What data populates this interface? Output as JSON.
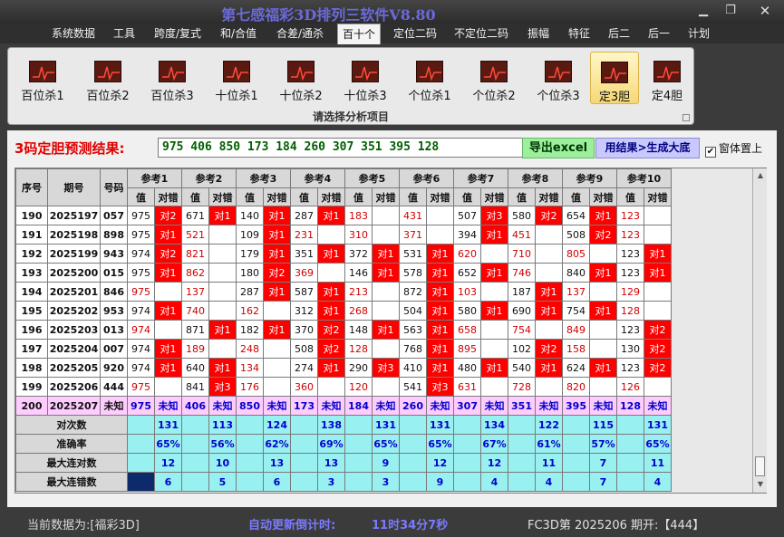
{
  "window": {
    "title": "第七感福彩3D排列三软件V8.80"
  },
  "menu": [
    "系统数据",
    "工具",
    "跨度/复式",
    "和/合值",
    "合差/通杀",
    "百十个",
    "定位二码",
    "不定位二码",
    "振幅",
    "特征",
    "后二",
    "后一",
    "计划"
  ],
  "active_menu": "百十个",
  "ribbon": {
    "buttons": [
      "百位杀1",
      "百位杀2",
      "百位杀3",
      "十位杀1",
      "十位杀2",
      "十位杀3",
      "个位杀1",
      "个位杀2",
      "个位杀3",
      "定3胆",
      "定4胆"
    ],
    "active": "定3胆",
    "caption": "请选择分析项目"
  },
  "prediction": {
    "label": "3码定胆预测结果:",
    "value": "975 406 850 173 184 260 307 351 395 128",
    "export_button": "导出excel",
    "bigbase_button": "用结果>生成大底",
    "pin_label": "窗体置上",
    "pin_checked": "✔"
  },
  "table": {
    "headers": {
      "seq": "序号",
      "period": "期号",
      "number": "号码",
      "val": "值",
      "hit": "对错"
    },
    "refs": [
      "参考1",
      "参考2",
      "参考3",
      "参考4",
      "参考5",
      "参考6",
      "参考7",
      "参考8",
      "参考9",
      "参考10"
    ],
    "rows": [
      {
        "seq": "190",
        "period": "2025197",
        "num": "057",
        "cells": [
          [
            "975",
            "对2"
          ],
          [
            "671",
            "对1"
          ],
          [
            "140",
            "对1"
          ],
          [
            "287",
            "对1"
          ],
          [
            "183",
            ""
          ],
          [
            "431",
            ""
          ],
          [
            "507",
            "对3"
          ],
          [
            "580",
            "对2"
          ],
          [
            "654",
            "对1"
          ],
          [
            "123",
            ""
          ]
        ]
      },
      {
        "seq": "191",
        "period": "2025198",
        "num": "898",
        "cells": [
          [
            "975",
            "对1"
          ],
          [
            "521",
            ""
          ],
          [
            "109",
            "对1"
          ],
          [
            "231",
            ""
          ],
          [
            "310",
            ""
          ],
          [
            "371",
            ""
          ],
          [
            "394",
            "对1"
          ],
          [
            "451",
            ""
          ],
          [
            "508",
            "对2"
          ],
          [
            "123",
            ""
          ]
        ]
      },
      {
        "seq": "192",
        "period": "2025199",
        "num": "943",
        "cells": [
          [
            "974",
            "对2"
          ],
          [
            "821",
            ""
          ],
          [
            "179",
            "对1"
          ],
          [
            "351",
            "对1"
          ],
          [
            "372",
            "对1"
          ],
          [
            "531",
            "对1"
          ],
          [
            "620",
            ""
          ],
          [
            "710",
            ""
          ],
          [
            "805",
            ""
          ],
          [
            "123",
            "对1"
          ]
        ]
      },
      {
        "seq": "193",
        "period": "2025200",
        "num": "015",
        "cells": [
          [
            "975",
            "对1"
          ],
          [
            "862",
            ""
          ],
          [
            "180",
            "对2"
          ],
          [
            "369",
            ""
          ],
          [
            "146",
            "对1"
          ],
          [
            "578",
            "对1"
          ],
          [
            "652",
            "对1"
          ],
          [
            "746",
            ""
          ],
          [
            "840",
            "对1"
          ],
          [
            "123",
            "对1"
          ]
        ]
      },
      {
        "seq": "194",
        "period": "2025201",
        "num": "846",
        "cells": [
          [
            "975",
            ""
          ],
          [
            "137",
            ""
          ],
          [
            "287",
            "对1"
          ],
          [
            "587",
            "对1"
          ],
          [
            "213",
            ""
          ],
          [
            "872",
            "对1"
          ],
          [
            "103",
            ""
          ],
          [
            "187",
            "对1"
          ],
          [
            "137",
            ""
          ],
          [
            "129",
            ""
          ]
        ]
      },
      {
        "seq": "195",
        "period": "2025202",
        "num": "953",
        "cells": [
          [
            "974",
            "对1"
          ],
          [
            "740",
            ""
          ],
          [
            "162",
            ""
          ],
          [
            "312",
            "对1"
          ],
          [
            "268",
            ""
          ],
          [
            "504",
            "对1"
          ],
          [
            "580",
            "对1"
          ],
          [
            "690",
            "对1"
          ],
          [
            "754",
            "对1"
          ],
          [
            "128",
            ""
          ]
        ]
      },
      {
        "seq": "196",
        "period": "2025203",
        "num": "013",
        "cells": [
          [
            "974",
            ""
          ],
          [
            "871",
            "对1"
          ],
          [
            "182",
            "对1"
          ],
          [
            "370",
            "对2"
          ],
          [
            "148",
            "对1"
          ],
          [
            "563",
            "对1"
          ],
          [
            "658",
            ""
          ],
          [
            "754",
            ""
          ],
          [
            "849",
            ""
          ],
          [
            "123",
            "对2"
          ]
        ]
      },
      {
        "seq": "197",
        "period": "2025204",
        "num": "007",
        "cells": [
          [
            "974",
            "对1"
          ],
          [
            "189",
            ""
          ],
          [
            "248",
            ""
          ],
          [
            "508",
            "对2"
          ],
          [
            "128",
            ""
          ],
          [
            "768",
            "对1"
          ],
          [
            "895",
            ""
          ],
          [
            "102",
            "对2"
          ],
          [
            "158",
            ""
          ],
          [
            "130",
            "对2"
          ]
        ]
      },
      {
        "seq": "198",
        "period": "2025205",
        "num": "920",
        "cells": [
          [
            "974",
            "对1"
          ],
          [
            "640",
            "对1"
          ],
          [
            "134",
            ""
          ],
          [
            "274",
            "对1"
          ],
          [
            "290",
            "对3"
          ],
          [
            "410",
            "对1"
          ],
          [
            "480",
            "对1"
          ],
          [
            "540",
            "对1"
          ],
          [
            "624",
            "对1"
          ],
          [
            "123",
            "对2"
          ]
        ]
      },
      {
        "seq": "199",
        "period": "2025206",
        "num": "444",
        "cells": [
          [
            "975",
            ""
          ],
          [
            "841",
            "对3"
          ],
          [
            "176",
            ""
          ],
          [
            "360",
            ""
          ],
          [
            "120",
            ""
          ],
          [
            "541",
            "对3"
          ],
          [
            "631",
            ""
          ],
          [
            "728",
            ""
          ],
          [
            "820",
            ""
          ],
          [
            "126",
            ""
          ]
        ]
      }
    ],
    "pred_row": {
      "seq": "200",
      "period": "2025207",
      "num": "未知",
      "cells": [
        [
          "975",
          "未知"
        ],
        [
          "406",
          "未知"
        ],
        [
          "850",
          "未知"
        ],
        [
          "173",
          "未知"
        ],
        [
          "184",
          "未知"
        ],
        [
          "260",
          "未知"
        ],
        [
          "307",
          "未知"
        ],
        [
          "351",
          "未知"
        ],
        [
          "395",
          "未知"
        ],
        [
          "128",
          "未知"
        ]
      ]
    },
    "stats": [
      {
        "label": "对次数",
        "values": [
          "131",
          "113",
          "124",
          "138",
          "131",
          "131",
          "134",
          "122",
          "115",
          "131"
        ]
      },
      {
        "label": "准确率",
        "values": [
          "65%",
          "56%",
          "62%",
          "69%",
          "65%",
          "65%",
          "67%",
          "61%",
          "57%",
          "65%"
        ]
      },
      {
        "label": "最大连对数",
        "values": [
          "12",
          "10",
          "13",
          "13",
          "9",
          "12",
          "12",
          "11",
          "7",
          "11"
        ]
      },
      {
        "label": "最大连错数",
        "values": [
          "6",
          "5",
          "6",
          "3",
          "3",
          "9",
          "4",
          "4",
          "7",
          "4"
        ]
      }
    ]
  },
  "status": {
    "current": "当前数据为:[福彩3D]",
    "countdown_label": "自动更新倒计时:",
    "countdown": "11时34分7秒",
    "issue": "FC3D第 2025206 期开:【444】"
  },
  "colors": {
    "hit": "#ff0000",
    "predict_bg": "#ffccff",
    "stats_bg": "#99f0f0",
    "title": "#6a6ad8",
    "accent": "#d00000"
  },
  "icons": {
    "minimize": "minimize-icon",
    "maximize": "maximize-icon",
    "close": "close-icon",
    "chart": "trend-chart-icon",
    "check": "check-icon",
    "scroll_up": "scroll-up-icon",
    "scroll_down": "scroll-down-icon"
  }
}
